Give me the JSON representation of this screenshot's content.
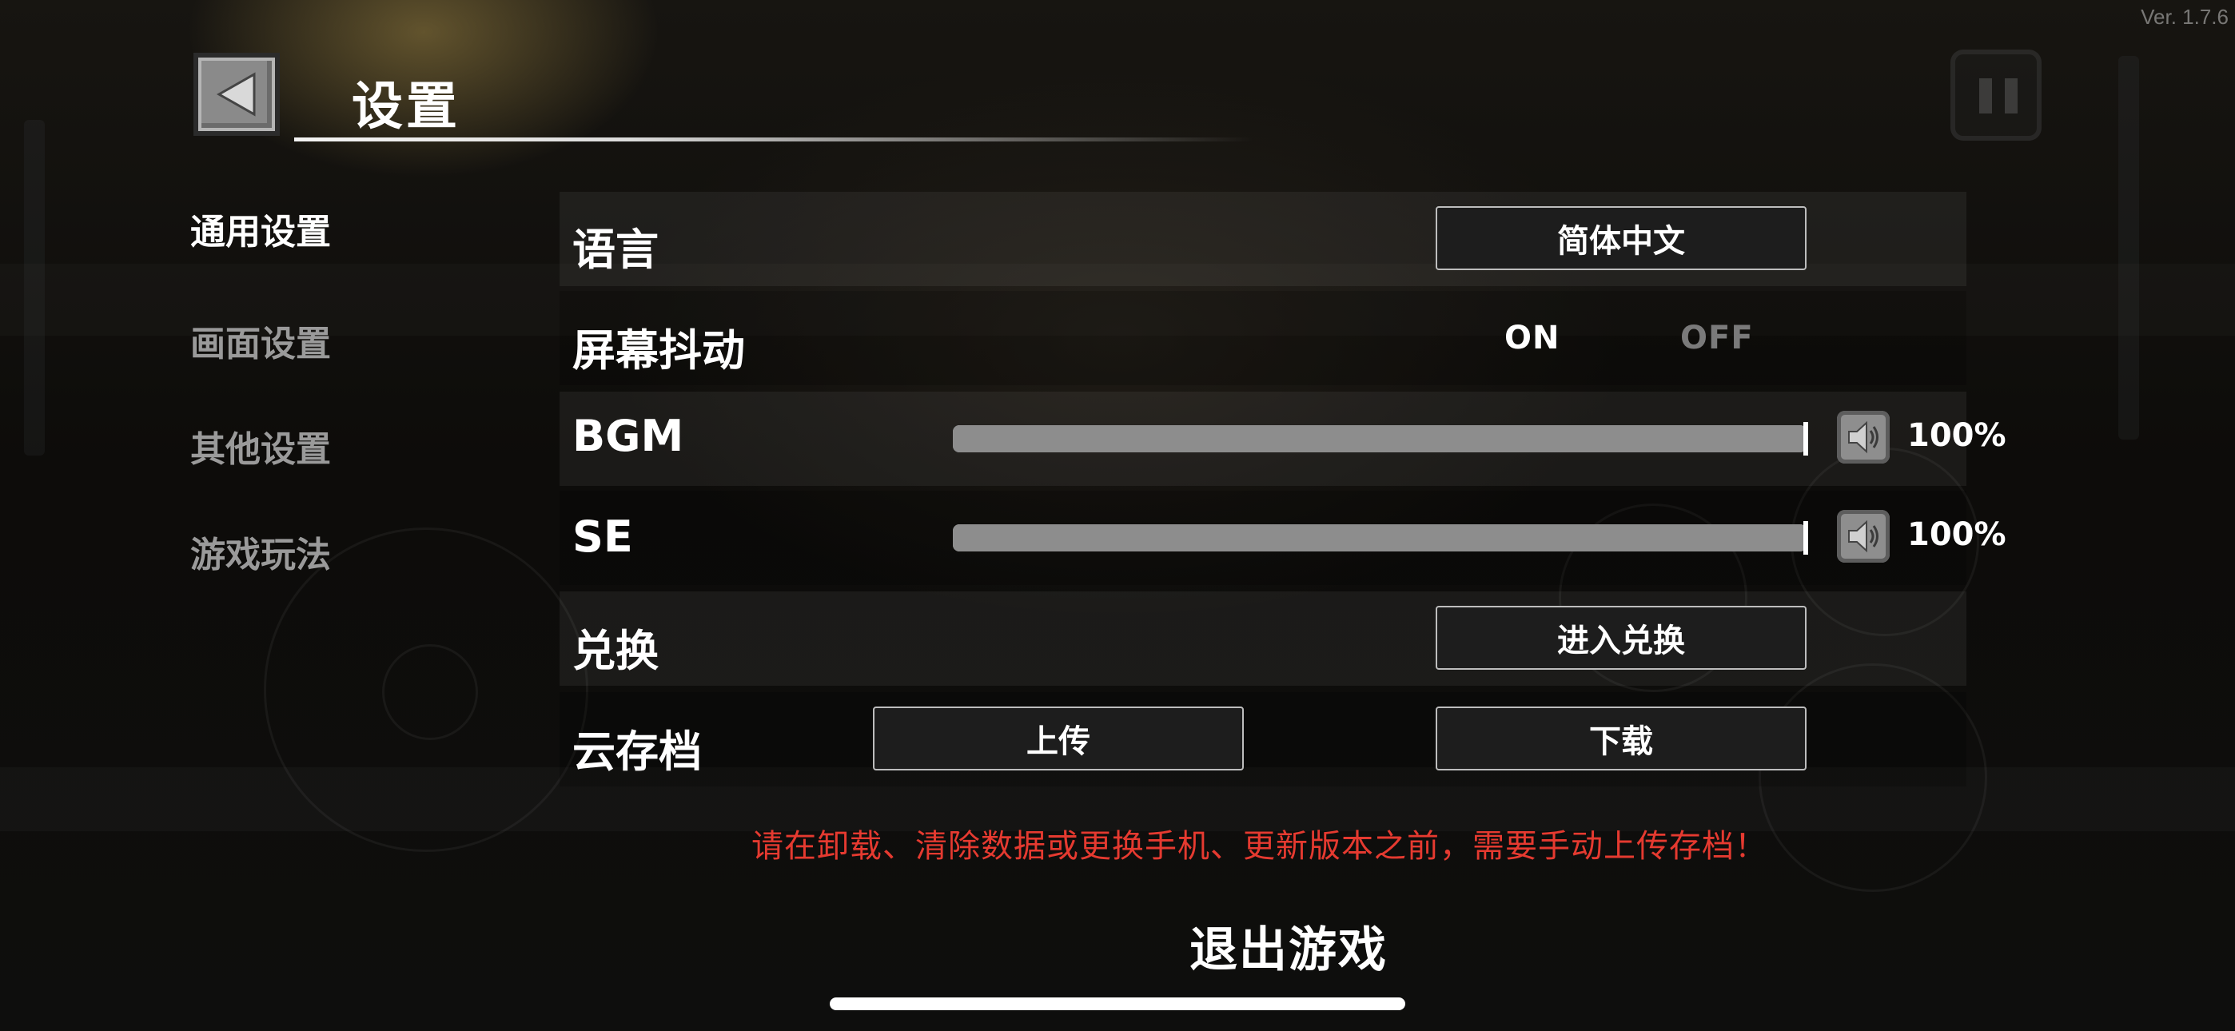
{
  "version_text": "Ver. 1.7.6",
  "header": {
    "title": "设置"
  },
  "sidebar": {
    "items": [
      {
        "label": "通用设置",
        "active": true
      },
      {
        "label": "画面设置",
        "active": false
      },
      {
        "label": "其他设置",
        "active": false
      },
      {
        "label": "游戏玩法",
        "active": false
      }
    ]
  },
  "settings": {
    "language": {
      "label": "语言",
      "value": "简体中文"
    },
    "screen_shake": {
      "label": "屏幕抖动",
      "on_label": "ON",
      "off_label": "OFF",
      "selected": "ON"
    },
    "bgm": {
      "label": "BGM",
      "percent_text": "100%",
      "level": 1.0
    },
    "se": {
      "label": "SE",
      "percent_text": "100%",
      "level": 1.0
    },
    "redeem": {
      "label": "兑换",
      "button_label": "进入兑换"
    },
    "cloud_save": {
      "label": "云存档",
      "upload_label": "上传",
      "download_label": "下载"
    }
  },
  "warning_text": "请在卸载、清除数据或更换手机、更新版本之前，需要手动上传存档！",
  "exit_label": "退出游戏",
  "colors": {
    "warning": "#e53a30",
    "inactive_text": "#9a9a9a",
    "slider": "#8d8d8d"
  }
}
